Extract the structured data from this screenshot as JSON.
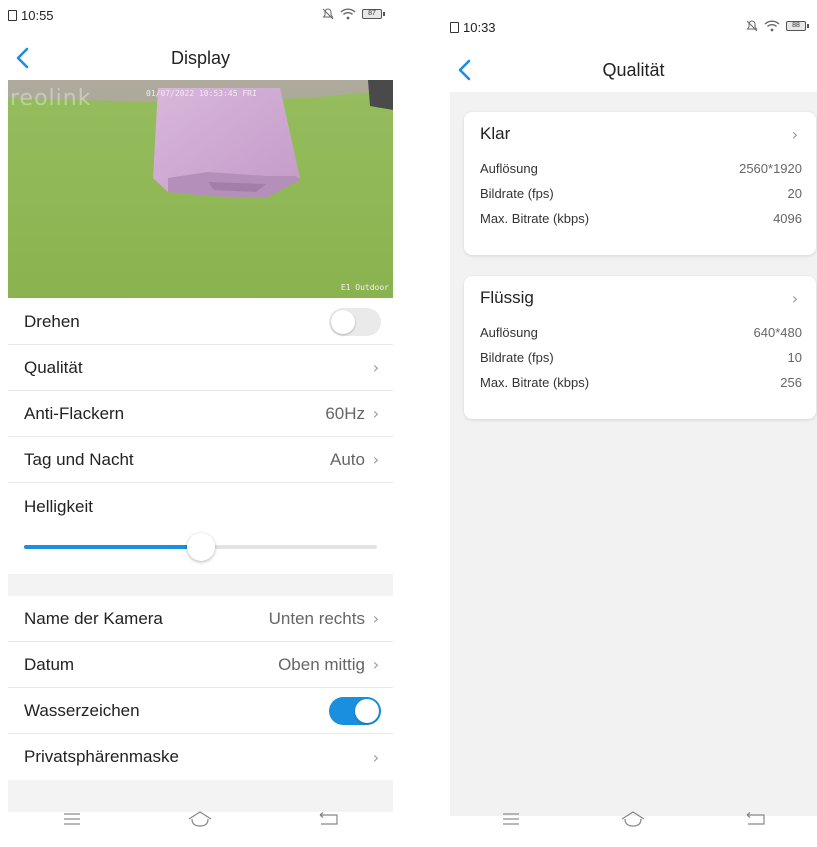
{
  "left": {
    "status": {
      "time": "10:55",
      "battery": "87"
    },
    "nav": {
      "title": "Display"
    },
    "camera": {
      "logo": "reolink",
      "datetime": "01/07/2022 10:53:45 FRI",
      "cam_name": "E1 Outdoor"
    },
    "rows": {
      "drehen": {
        "label": "Drehen",
        "state": "off"
      },
      "qualitaet": {
        "label": "Qualität"
      },
      "anti_flackern": {
        "label": "Anti-Flackern",
        "value": "60Hz"
      },
      "tag_nacht": {
        "label": "Tag und Nacht",
        "value": "Auto"
      },
      "helligkeit": {
        "label": "Helligkeit",
        "level": 0.5
      },
      "name_kamera": {
        "label": "Name der Kamera",
        "value": "Unten rechts"
      },
      "datum": {
        "label": "Datum",
        "value": "Oben mittig"
      },
      "wasserzeichen": {
        "label": "Wasserzeichen",
        "state": "on"
      },
      "privatsphaere": {
        "label": "Privatsphärenmaske"
      }
    }
  },
  "right": {
    "status": {
      "time": "10:33",
      "battery": "88"
    },
    "nav": {
      "title": "Qualität"
    },
    "cards": [
      {
        "title": "Klar",
        "rows": [
          {
            "key": "Auflösung",
            "value": "2560*1920"
          },
          {
            "key": "Bildrate (fps)",
            "value": "20"
          },
          {
            "key": "Max. Bitrate (kbps)",
            "value": "4096"
          }
        ]
      },
      {
        "title": "Flüssig",
        "rows": [
          {
            "key": "Auflösung",
            "value": "640*480"
          },
          {
            "key": "Bildrate (fps)",
            "value": "10"
          },
          {
            "key": "Max. Bitrate (kbps)",
            "value": "256"
          }
        ]
      }
    ]
  },
  "icons": {
    "back": "chevron-left-icon",
    "chevron": "chevron-right-icon",
    "menu": "menu-icon",
    "home": "home-icon",
    "return": "return-icon"
  },
  "colors": {
    "accent": "#1a8fe0",
    "divider": "#e8e8e8",
    "section_bg": "#f3f3f3"
  }
}
